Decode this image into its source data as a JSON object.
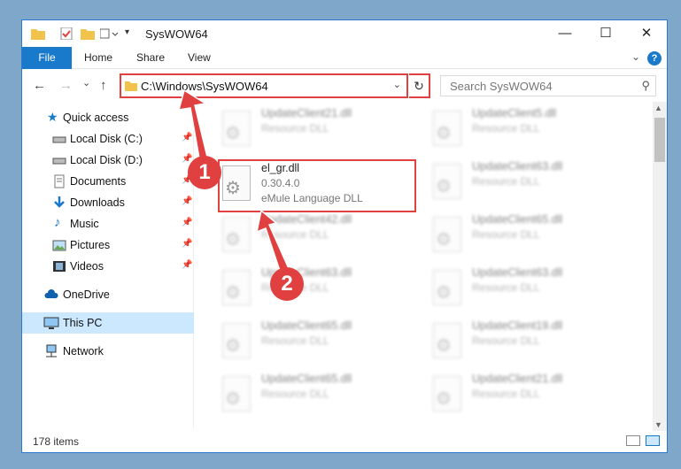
{
  "window": {
    "title": "SysWOW64"
  },
  "ribbon": {
    "file": "File",
    "home": "Home",
    "share": "Share",
    "view": "View",
    "help": "?"
  },
  "nav": {
    "back": "←",
    "forward": "→",
    "recent": "⌄",
    "up": "↑",
    "address": "C:\\Windows\\SysWOW64",
    "refresh": "↻",
    "search_placeholder": "Search SysWOW64"
  },
  "sidebar": {
    "items": [
      {
        "label": "Quick access"
      },
      {
        "label": "Local Disk (C:)"
      },
      {
        "label": "Local Disk (D:)"
      },
      {
        "label": "Documents"
      },
      {
        "label": "Downloads"
      },
      {
        "label": "Music"
      },
      {
        "label": "Pictures"
      },
      {
        "label": "Videos"
      },
      {
        "label": "OneDrive"
      },
      {
        "label": "This PC"
      },
      {
        "label": "Network"
      }
    ]
  },
  "files": [
    {
      "name": "UpdateClient21.dll",
      "type": "Resource DLL"
    },
    {
      "name": "UpdateClient5.dll",
      "type": "Resource DLL"
    },
    {
      "name": "el_gr.dll",
      "version": "0.30.4.0",
      "type": "eMule Language DLL"
    },
    {
      "name": "UpdateClient63.dll",
      "type": "Resource DLL"
    },
    {
      "name": "UpdateClient42.dll",
      "type": "Resource DLL"
    },
    {
      "name": "UpdateClient65.dll",
      "type": "Resource DLL"
    },
    {
      "name": "UpdateClient63.dll",
      "type": "Resource DLL"
    },
    {
      "name": "UpdateClient63.dll",
      "type": "Resource DLL"
    },
    {
      "name": "UpdateClient65.dll",
      "type": "Resource DLL"
    },
    {
      "name": "UpdateClient19.dll",
      "type": "Resource DLL"
    },
    {
      "name": "UpdateClient65.dll",
      "type": "Resource DLL"
    },
    {
      "name": "UpdateClient21.dll",
      "type": "Resource DLL"
    }
  ],
  "status": {
    "items": "178 items"
  },
  "annotations": {
    "step1": "1",
    "step2": "2"
  },
  "colors": {
    "accent": "#1979ca",
    "highlight": "#e04040"
  }
}
